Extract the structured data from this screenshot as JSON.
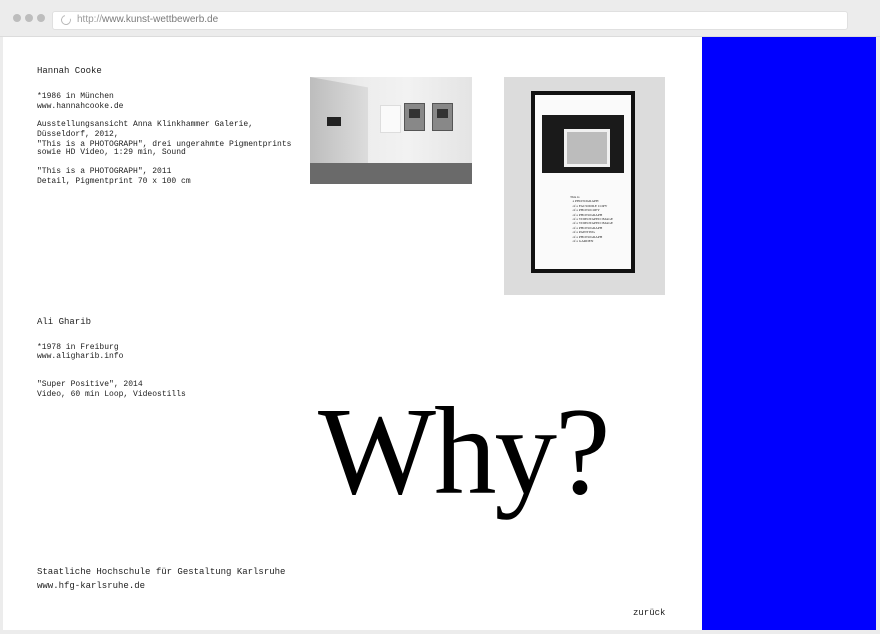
{
  "browser": {
    "url_protocol": "http://",
    "url_host": "www.kunst-wettbewerb.de"
  },
  "artist1": {
    "name": "Hannah Cooke",
    "birth": "*1986 in München",
    "website": "www.hannahcooke.de",
    "desc1_l1": "Ausstellungsansicht Anna Klinkhammer Galerie,",
    "desc1_l2": "Düsseldorf, 2012,",
    "desc1_l3": "\"This is a PHOTOGRAPH\", drei ungerahmte Pigmentprints",
    "desc1_l4": "sowie HD Video, 1:29 min, Sound",
    "desc2_l1": "\"This is a PHOTOGRAPH\", 2011",
    "desc2_l2": "Detail, Pigmentprint 70 x 100 cm",
    "print_title": "This is",
    "print_lines": [
      "a PHOTOGRAPH",
      "of a FACSIMILE COPY",
      "of a PHOTOCOPY",
      "of a PHOTOGRAPH",
      "of a VIDEOTAPED IMAGE",
      "of a VIDEOTAPED IMAGE",
      "of a PHOTOGRAPH",
      "of a PAINTING",
      "of a PHOTOGRAPH",
      "of a GARDEN"
    ]
  },
  "artist2": {
    "name": "Ali Gharib",
    "birth": "*1978 in Freiburg",
    "website": "www.aligharib.info",
    "desc_l1": "\"Super Positive\", 2014",
    "desc_l2": "Video, 60 min Loop, Videostills"
  },
  "headline": "Why?",
  "footer": {
    "school": "Staatliche Hochschule für Gestaltung Karlsruhe",
    "website": "www.hfg-karlsruhe.de",
    "back": "zurück"
  },
  "colors": {
    "accent_blue": "#0000ff"
  }
}
